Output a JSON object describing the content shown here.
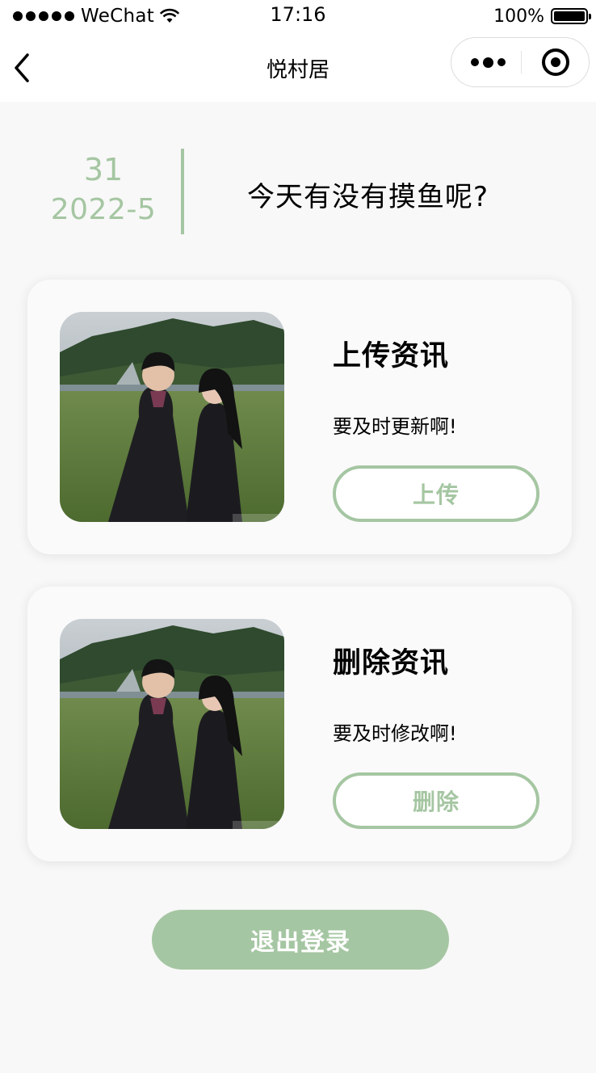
{
  "status_bar": {
    "carrier": "WeChat",
    "time": "17:16",
    "battery": "100%"
  },
  "nav": {
    "title": "悦村居"
  },
  "date": {
    "day": "31",
    "year_month": "2022-5"
  },
  "greeting": "今天有没有摸鱼呢?",
  "cards": [
    {
      "title": "上传资讯",
      "subtitle": "要及时更新啊!",
      "button": "上传",
      "photo_icon": "couple-photo"
    },
    {
      "title": "删除资讯",
      "subtitle": "要及时修改啊!",
      "button": "删除",
      "photo_icon": "couple-photo"
    }
  ],
  "logout_button": "退出登录",
  "colors": {
    "accent": "#a5c6a2",
    "background": "#f8f8f8",
    "card": "#fafafa"
  }
}
